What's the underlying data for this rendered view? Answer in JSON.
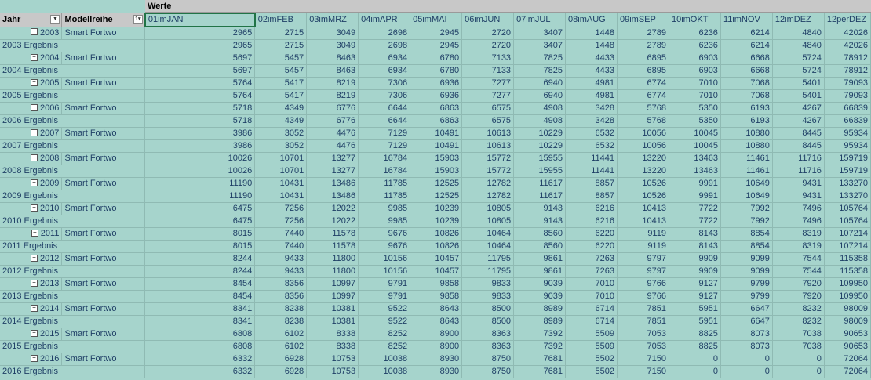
{
  "header": {
    "werte_label": "Werte",
    "jahr_label": "Jahr",
    "modellreihe_label": "Modellreihe",
    "months": [
      "01imJAN",
      "02imFEB",
      "03imMRZ",
      "04imAPR",
      "05imMAI",
      "06imJUN",
      "07imJUL",
      "08imAUG",
      "09imSEP",
      "10imOKT",
      "11imNOV",
      "12imDEZ",
      "12perDEZ"
    ]
  },
  "icons": {
    "collapse": "minus-box-icon",
    "dropdown": "dropdown-arrow-icon",
    "filter": "filter-dropdown-icon"
  },
  "colors": {
    "background": "#a6d4cc",
    "header": "#c8c8c8",
    "text": "#1f3f66",
    "selection": "#217346"
  },
  "model_name": "Smart Fortwo",
  "rows": [
    {
      "year": "2003",
      "model": "Smart Fortwo",
      "values": [
        "2965",
        "2715",
        "3049",
        "2698",
        "2945",
        "2720",
        "3407",
        "1448",
        "2789",
        "6236",
        "6214",
        "4840",
        "42026"
      ]
    },
    {
      "ergebnis": "2003 Ergebnis",
      "values": [
        "2965",
        "2715",
        "3049",
        "2698",
        "2945",
        "2720",
        "3407",
        "1448",
        "2789",
        "6236",
        "6214",
        "4840",
        "42026"
      ]
    },
    {
      "year": "2004",
      "model": "Smart Fortwo",
      "values": [
        "5697",
        "5457",
        "8463",
        "6934",
        "6780",
        "7133",
        "7825",
        "4433",
        "6895",
        "6903",
        "6668",
        "5724",
        "78912"
      ]
    },
    {
      "ergebnis": "2004 Ergebnis",
      "values": [
        "5697",
        "5457",
        "8463",
        "6934",
        "6780",
        "7133",
        "7825",
        "4433",
        "6895",
        "6903",
        "6668",
        "5724",
        "78912"
      ]
    },
    {
      "year": "2005",
      "model": "Smart Fortwo",
      "values": [
        "5764",
        "5417",
        "8219",
        "7306",
        "6936",
        "7277",
        "6940",
        "4981",
        "6774",
        "7010",
        "7068",
        "5401",
        "79093"
      ]
    },
    {
      "ergebnis": "2005 Ergebnis",
      "values": [
        "5764",
        "5417",
        "8219",
        "7306",
        "6936",
        "7277",
        "6940",
        "4981",
        "6774",
        "7010",
        "7068",
        "5401",
        "79093"
      ]
    },
    {
      "year": "2006",
      "model": "Smart Fortwo",
      "values": [
        "5718",
        "4349",
        "6776",
        "6644",
        "6863",
        "6575",
        "4908",
        "3428",
        "5768",
        "5350",
        "6193",
        "4267",
        "66839"
      ]
    },
    {
      "ergebnis": "2006 Ergebnis",
      "values": [
        "5718",
        "4349",
        "6776",
        "6644",
        "6863",
        "6575",
        "4908",
        "3428",
        "5768",
        "5350",
        "6193",
        "4267",
        "66839"
      ]
    },
    {
      "year": "2007",
      "model": "Smart Fortwo",
      "values": [
        "3986",
        "3052",
        "4476",
        "7129",
        "10491",
        "10613",
        "10229",
        "6532",
        "10056",
        "10045",
        "10880",
        "8445",
        "95934"
      ]
    },
    {
      "ergebnis": "2007 Ergebnis",
      "values": [
        "3986",
        "3052",
        "4476",
        "7129",
        "10491",
        "10613",
        "10229",
        "6532",
        "10056",
        "10045",
        "10880",
        "8445",
        "95934"
      ]
    },
    {
      "year": "2008",
      "model": "Smart Fortwo",
      "values": [
        "10026",
        "10701",
        "13277",
        "16784",
        "15903",
        "15772",
        "15955",
        "11441",
        "13220",
        "13463",
        "11461",
        "11716",
        "159719"
      ]
    },
    {
      "ergebnis": "2008 Ergebnis",
      "values": [
        "10026",
        "10701",
        "13277",
        "16784",
        "15903",
        "15772",
        "15955",
        "11441",
        "13220",
        "13463",
        "11461",
        "11716",
        "159719"
      ]
    },
    {
      "year": "2009",
      "model": "Smart Fortwo",
      "values": [
        "11190",
        "10431",
        "13486",
        "11785",
        "12525",
        "12782",
        "11617",
        "8857",
        "10526",
        "9991",
        "10649",
        "9431",
        "133270"
      ]
    },
    {
      "ergebnis": "2009 Ergebnis",
      "values": [
        "11190",
        "10431",
        "13486",
        "11785",
        "12525",
        "12782",
        "11617",
        "8857",
        "10526",
        "9991",
        "10649",
        "9431",
        "133270"
      ]
    },
    {
      "year": "2010",
      "model": "Smart Fortwo",
      "values": [
        "6475",
        "7256",
        "12022",
        "9985",
        "10239",
        "10805",
        "9143",
        "6216",
        "10413",
        "7722",
        "7992",
        "7496",
        "105764"
      ]
    },
    {
      "ergebnis": "2010 Ergebnis",
      "values": [
        "6475",
        "7256",
        "12022",
        "9985",
        "10239",
        "10805",
        "9143",
        "6216",
        "10413",
        "7722",
        "7992",
        "7496",
        "105764"
      ]
    },
    {
      "year": "2011",
      "model": "Smart Fortwo",
      "values": [
        "8015",
        "7440",
        "11578",
        "9676",
        "10826",
        "10464",
        "8560",
        "6220",
        "9119",
        "8143",
        "8854",
        "8319",
        "107214"
      ]
    },
    {
      "ergebnis": "2011 Ergebnis",
      "values": [
        "8015",
        "7440",
        "11578",
        "9676",
        "10826",
        "10464",
        "8560",
        "6220",
        "9119",
        "8143",
        "8854",
        "8319",
        "107214"
      ]
    },
    {
      "year": "2012",
      "model": "Smart Fortwo",
      "values": [
        "8244",
        "9433",
        "11800",
        "10156",
        "10457",
        "11795",
        "9861",
        "7263",
        "9797",
        "9909",
        "9099",
        "7544",
        "115358"
      ]
    },
    {
      "ergebnis": "2012 Ergebnis",
      "values": [
        "8244",
        "9433",
        "11800",
        "10156",
        "10457",
        "11795",
        "9861",
        "7263",
        "9797",
        "9909",
        "9099",
        "7544",
        "115358"
      ]
    },
    {
      "year": "2013",
      "model": "Smart Fortwo",
      "values": [
        "8454",
        "8356",
        "10997",
        "9791",
        "9858",
        "9833",
        "9039",
        "7010",
        "9766",
        "9127",
        "9799",
        "7920",
        "109950"
      ]
    },
    {
      "ergebnis": "2013 Ergebnis",
      "values": [
        "8454",
        "8356",
        "10997",
        "9791",
        "9858",
        "9833",
        "9039",
        "7010",
        "9766",
        "9127",
        "9799",
        "7920",
        "109950"
      ]
    },
    {
      "year": "2014",
      "model": "Smart Fortwo",
      "values": [
        "8341",
        "8238",
        "10381",
        "9522",
        "8643",
        "8500",
        "8989",
        "6714",
        "7851",
        "5951",
        "6647",
        "8232",
        "98009"
      ]
    },
    {
      "ergebnis": "2014 Ergebnis",
      "values": [
        "8341",
        "8238",
        "10381",
        "9522",
        "8643",
        "8500",
        "8989",
        "6714",
        "7851",
        "5951",
        "6647",
        "8232",
        "98009"
      ]
    },
    {
      "year": "2015",
      "model": "Smart Fortwo",
      "values": [
        "6808",
        "6102",
        "8338",
        "8252",
        "8900",
        "8363",
        "7392",
        "5509",
        "7053",
        "8825",
        "8073",
        "7038",
        "90653"
      ]
    },
    {
      "ergebnis": "2015 Ergebnis",
      "values": [
        "6808",
        "6102",
        "8338",
        "8252",
        "8900",
        "8363",
        "7392",
        "5509",
        "7053",
        "8825",
        "8073",
        "7038",
        "90653"
      ]
    },
    {
      "year": "2016",
      "model": "Smart Fortwo",
      "values": [
        "6332",
        "6928",
        "10753",
        "10038",
        "8930",
        "8750",
        "7681",
        "5502",
        "7150",
        "0",
        "0",
        "0",
        "72064"
      ]
    },
    {
      "ergebnis": "2016 Ergebnis",
      "values": [
        "6332",
        "6928",
        "10753",
        "10038",
        "8930",
        "8750",
        "7681",
        "5502",
        "7150",
        "0",
        "0",
        "0",
        "72064"
      ]
    }
  ]
}
